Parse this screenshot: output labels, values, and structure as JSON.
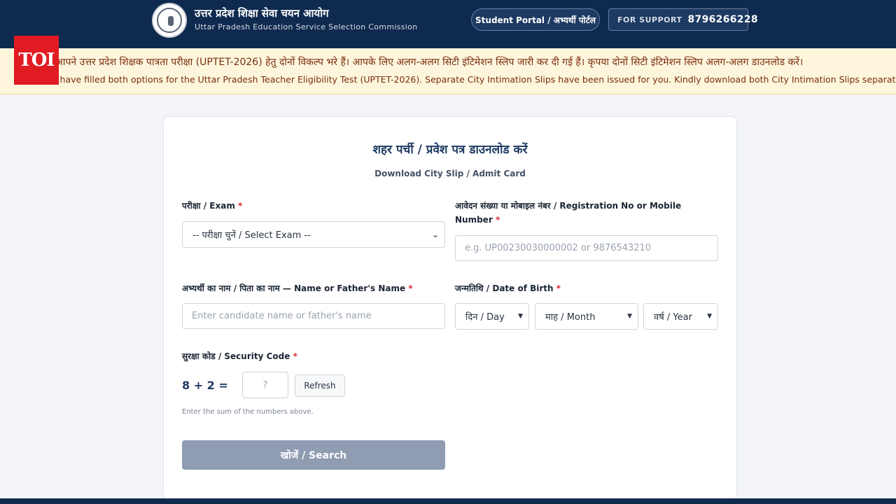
{
  "header": {
    "org_hindi": "उत्तर प्रदेश शिक्षा सेवा चयन आयोग",
    "org_english": "Uttar Pradesh Education Service Selection Commission",
    "portal_button": "Student Portal / अभ्यर्थी पोर्टल",
    "support_label": "FOR SUPPORT",
    "support_number": "8796266228"
  },
  "notice": {
    "hindi": ": आपने उत्तर प्रदेश शिक्षक पात्रता परीक्षा (UPTET-2026) हेतु दोनों विकल्प भरे हैं। आपके लिए अलग-अलग सिटी इंटिमेशन स्लिप जारी कर दी गई हैं। कृपया दोनों सिटी इंटिमेशन स्लिप अलग-अलग डाउनलोड करें।",
    "english": "ou have filled both options for the Uttar Pradesh Teacher Eligibility Test (UPTET-2026). Separate City Intimation Slips have been issued for you. Kindly download both City Intimation Slips separately."
  },
  "watermark": "TOI",
  "form": {
    "title": "शहर पर्ची / प्रवेश पत्र डाउनलोड करें",
    "subtitle": "Download City Slip / Admit Card",
    "exam_label": "परीक्षा / Exam",
    "exam_placeholder": "-- परीक्षा चुनें / Select Exam --",
    "reg_label": "आवेदन संख्या या मोबाइल नंबर / Registration No or Mobile Number",
    "reg_placeholder": "e.g. UP00230030000002 or 9876543210",
    "name_label": "अभ्यर्थी का नाम / पिता का नाम — Name or Father's Name",
    "name_placeholder": "Enter candidate name or father's name",
    "dob_label": "जन्मतिथि / Date of Birth",
    "dob_day": "दिन / Day",
    "dob_month": "माह / Month",
    "dob_year": "वर्ष / Year",
    "security_label": "सुरक्षा कोड / Security Code",
    "captcha_question": "8 + 2 =",
    "captcha_placeholder": "?",
    "refresh_label": "Refresh",
    "captcha_hint": "Enter the sum of the numbers above.",
    "search_label": "खोजें / Search",
    "required_mark": "*"
  },
  "icons": {
    "chevron": "chevron-down-icon",
    "emblem": "up-government-emblem-icon"
  },
  "colors": {
    "header_bg": "#0f2a4f",
    "notice_bg": "#fdf6dc",
    "notice_text": "#7a2c0f",
    "title_color": "#1f3a63",
    "required": "#d92b2b",
    "search_disabled": "#8f9cb1",
    "toi_red": "#e11b22"
  }
}
